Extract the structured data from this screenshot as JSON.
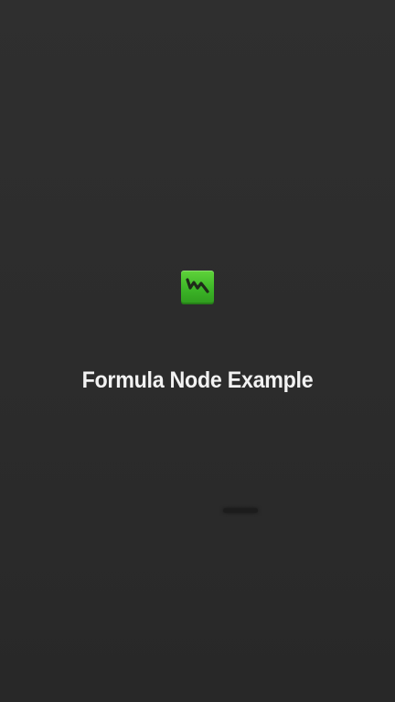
{
  "app": {
    "title": "Formula Node Example",
    "icon": "formula-node-logo-icon",
    "icon_color": "#4cc22f",
    "background_color": "#2d2d2d"
  }
}
